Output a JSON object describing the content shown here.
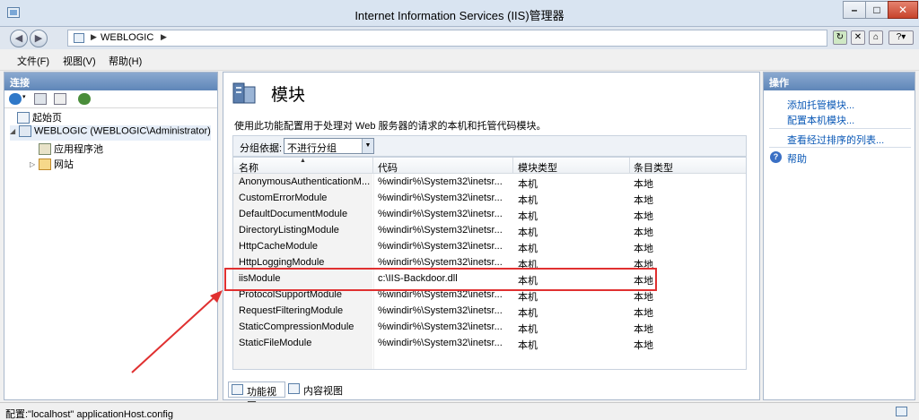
{
  "window": {
    "title": "Internet Information Services (IIS)管理器"
  },
  "address": {
    "crumb": "WEBLOGIC"
  },
  "menu": [
    {
      "label": "文件(F)"
    },
    {
      "label": "视图(V)"
    },
    {
      "label": "帮助(H)"
    }
  ],
  "left": {
    "header": "连接",
    "tree": [
      {
        "label": "起始页",
        "icon": "start-page-icon"
      },
      {
        "label": "WEBLOGIC (WEBLOGIC\\Administrator)",
        "icon": "server-icon"
      },
      {
        "label": "应用程序池",
        "icon": "app-pool-icon"
      },
      {
        "label": "网站",
        "icon": "sites-icon"
      }
    ]
  },
  "center": {
    "title": "模块",
    "description": "使用此功能配置用于处理对 Web 服务器的请求的本机和托管代码模块。",
    "group_label": "分组依据:",
    "group_value": "不进行分组",
    "columns": [
      "名称",
      "代码",
      "模块类型",
      "条目类型"
    ],
    "rows": [
      {
        "name": "AnonymousAuthenticationM...",
        "code": "%windir%\\System32\\inetsr...",
        "type": "本机",
        "entry": "本地"
      },
      {
        "name": "CustomErrorModule",
        "code": "%windir%\\System32\\inetsr...",
        "type": "本机",
        "entry": "本地"
      },
      {
        "name": "DefaultDocumentModule",
        "code": "%windir%\\System32\\inetsr...",
        "type": "本机",
        "entry": "本地"
      },
      {
        "name": "DirectoryListingModule",
        "code": "%windir%\\System32\\inetsr...",
        "type": "本机",
        "entry": "本地"
      },
      {
        "name": "HttpCacheModule",
        "code": "%windir%\\System32\\inetsr...",
        "type": "本机",
        "entry": "本地"
      },
      {
        "name": "HttpLoggingModule",
        "code": "%windir%\\System32\\inetsr...",
        "type": "本机",
        "entry": "本地"
      },
      {
        "name": "iisModule",
        "code": "c:\\IIS-Backdoor.dll",
        "type": "本机",
        "entry": "本地"
      },
      {
        "name": "ProtocolSupportModule",
        "code": "%windir%\\System32\\inetsr...",
        "type": "本机",
        "entry": "本地"
      },
      {
        "name": "RequestFilteringModule",
        "code": "%windir%\\System32\\inetsr...",
        "type": "本机",
        "entry": "本地"
      },
      {
        "name": "StaticCompressionModule",
        "code": "%windir%\\System32\\inetsr...",
        "type": "本机",
        "entry": "本地"
      },
      {
        "name": "StaticFileModule",
        "code": "%windir%\\System32\\inetsr...",
        "type": "本机",
        "entry": "本地"
      }
    ],
    "tabs": [
      {
        "label": "功能视图"
      },
      {
        "label": "内容视图"
      }
    ],
    "highlight_color": "#e03030"
  },
  "right": {
    "header": "操作",
    "actions": [
      {
        "label": "添加托管模块..."
      },
      {
        "label": "配置本机模块..."
      },
      {
        "label": "查看经过排序的列表..."
      }
    ],
    "help": "帮助"
  },
  "status": {
    "text": "配置:\"localhost\" applicationHost.config"
  }
}
